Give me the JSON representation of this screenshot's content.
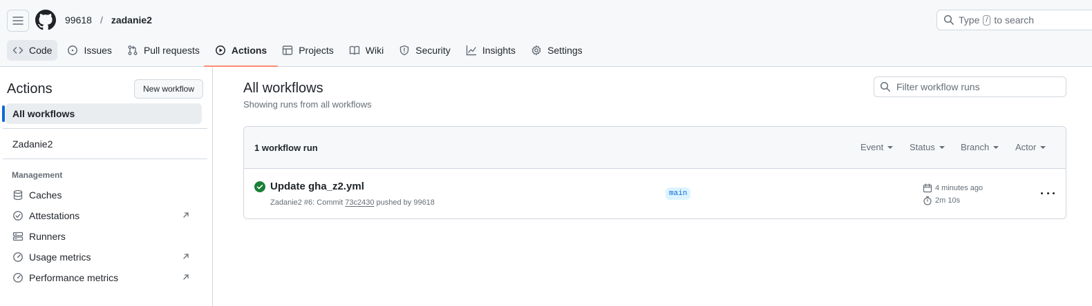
{
  "header": {
    "owner": "99618",
    "separator": "/",
    "repo": "zadanie2",
    "search": {
      "prefix": "Type",
      "key": "/",
      "suffix": "to search"
    }
  },
  "tabs": [
    {
      "label": "Code",
      "icon": "code-icon"
    },
    {
      "label": "Issues",
      "icon": "issue-icon"
    },
    {
      "label": "Pull requests",
      "icon": "pull-request-icon"
    },
    {
      "label": "Actions",
      "icon": "play-icon",
      "active": true
    },
    {
      "label": "Projects",
      "icon": "table-icon"
    },
    {
      "label": "Wiki",
      "icon": "book-icon"
    },
    {
      "label": "Security",
      "icon": "shield-icon"
    },
    {
      "label": "Insights",
      "icon": "graph-icon"
    },
    {
      "label": "Settings",
      "icon": "gear-icon"
    }
  ],
  "sidebar": {
    "title": "Actions",
    "new_workflow": "New workflow",
    "all_workflows": "All workflows",
    "workflows": [
      "Zadanie2"
    ],
    "management_heading": "Management",
    "management": [
      {
        "label": "Caches",
        "icon": "database-icon",
        "external": false
      },
      {
        "label": "Attestations",
        "icon": "verified-icon",
        "external": true
      },
      {
        "label": "Runners",
        "icon": "server-icon",
        "external": false
      },
      {
        "label": "Usage metrics",
        "icon": "meter-icon",
        "external": true
      },
      {
        "label": "Performance metrics",
        "icon": "meter-icon",
        "external": true
      }
    ]
  },
  "main": {
    "title": "All workflows",
    "subtitle": "Showing runs from all workflows",
    "filter_placeholder": "Filter workflow runs",
    "runs_count": "1 workflow run",
    "filters": [
      "Event",
      "Status",
      "Branch",
      "Actor"
    ],
    "run": {
      "title": "Update gha_z2.yml",
      "meta_prefix": "Zadanie2 #6: Commit",
      "sha": "73c2430",
      "meta_suffix": "pushed by 99618",
      "branch": "main",
      "time_ago": "4 minutes ago",
      "duration": "2m 10s",
      "status": "success"
    }
  },
  "colors": {
    "accent": "#0969da",
    "tab_underline": "#fd8c73",
    "success": "#1a7f37"
  }
}
